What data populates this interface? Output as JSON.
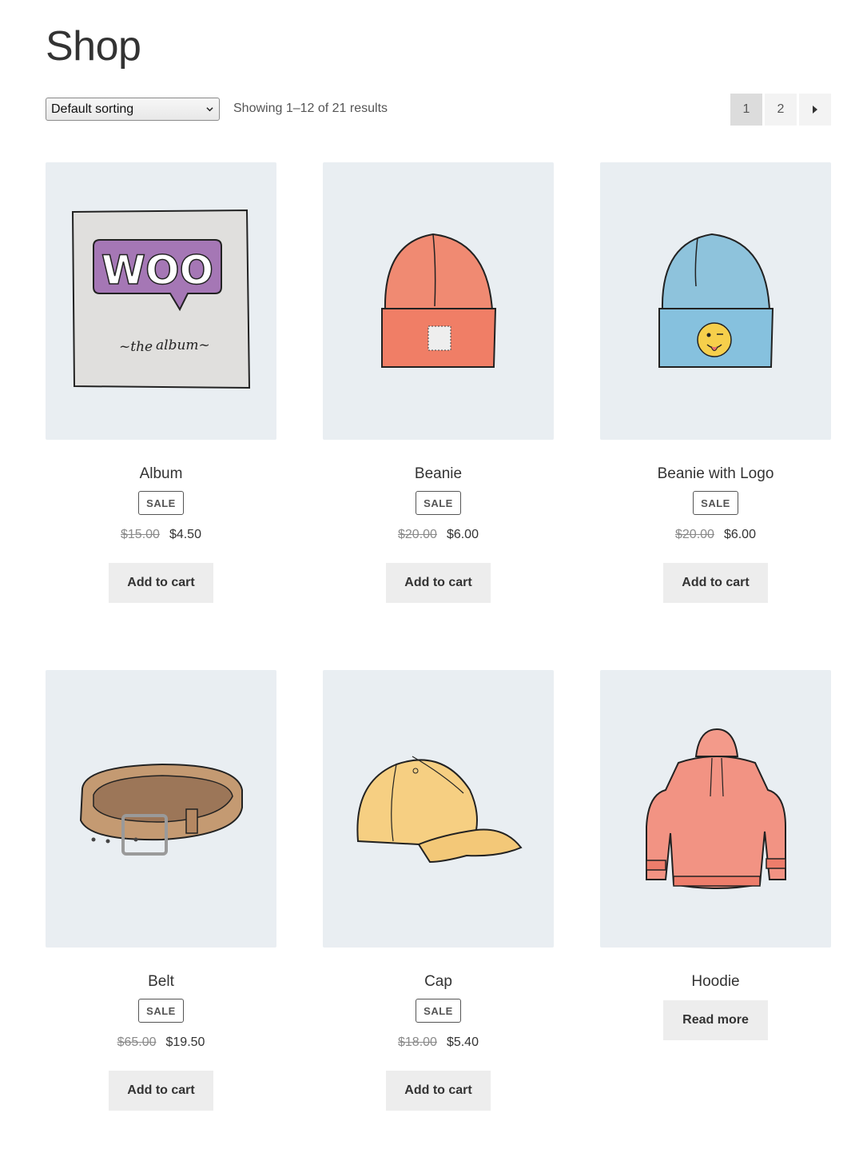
{
  "page": {
    "title": "Shop"
  },
  "toolbar": {
    "sort_selected": "Default sorting",
    "result_count": "Showing 1–12 of 21 results"
  },
  "pagination": {
    "pages": [
      "1",
      "2"
    ],
    "current": "1",
    "next_icon": "triangle-right-icon"
  },
  "products": [
    {
      "name": "Album",
      "sale_label": "SALE",
      "old_price": "$15.00",
      "price": "$4.50",
      "button": "Add to cart",
      "image_icon": "album-cover-icon"
    },
    {
      "name": "Beanie",
      "sale_label": "SALE",
      "old_price": "$20.00",
      "price": "$6.00",
      "button": "Add to cart",
      "image_icon": "beanie-icon"
    },
    {
      "name": "Beanie with Logo",
      "sale_label": "SALE",
      "old_price": "$20.00",
      "price": "$6.00",
      "button": "Add to cart",
      "image_icon": "beanie-logo-icon"
    },
    {
      "name": "Belt",
      "sale_label": "SALE",
      "old_price": "$65.00",
      "price": "$19.50",
      "button": "Add to cart",
      "image_icon": "belt-icon"
    },
    {
      "name": "Cap",
      "sale_label": "SALE",
      "old_price": "$18.00",
      "price": "$5.40",
      "button": "Add to cart",
      "image_icon": "cap-icon"
    },
    {
      "name": "Hoodie",
      "button": "Read more",
      "image_icon": "hoodie-icon"
    }
  ],
  "colors": {
    "thumb_bg": "#e9eef2",
    "button_bg": "#ededed",
    "text": "#333333"
  }
}
